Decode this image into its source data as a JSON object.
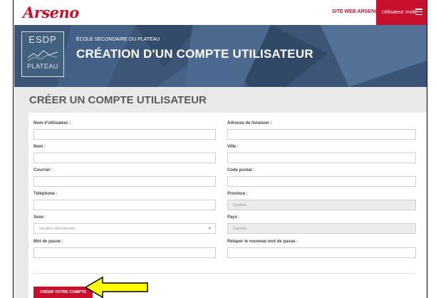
{
  "brand": {
    "logo": "Arseno",
    "accent": "#c8102e"
  },
  "nav": {
    "site_link": "SITE WEB ARSENO",
    "guest_label": "Utilisateur invité"
  },
  "banner": {
    "crest_top": "ESDP",
    "crest_bottom": "PLATEAU",
    "school": "ÉCOLE SECONDAIRE DU PLATEAU",
    "title": "CRÉATION D'UN COMPTE UTILISATEUR"
  },
  "page": {
    "title": "CRÉER UN COMPTE UTILISATEUR"
  },
  "form": {
    "left": [
      {
        "label": "Nom d'utilisateur :",
        "value": ""
      },
      {
        "label": "Nom :",
        "value": ""
      },
      {
        "label": "Courriel :",
        "value": ""
      },
      {
        "label": "Téléphone :",
        "value": ""
      },
      {
        "label": "Sexe :",
        "value": "Veuillez sélectionner..."
      },
      {
        "label": "Mot de passe :",
        "value": ""
      }
    ],
    "right": [
      {
        "label": "Adresse de livraison :",
        "value": ""
      },
      {
        "label": "Ville :",
        "value": ""
      },
      {
        "label": "Code postal :",
        "value": ""
      },
      {
        "label": "Province :",
        "value": "Québec"
      },
      {
        "label": "Pays :",
        "value": "Canada"
      },
      {
        "label": "Retaper le nouveau mot de passe :",
        "value": ""
      }
    ],
    "submit_label": "CRÉER VOTRE COMPTE"
  },
  "annotation": {
    "arrow_icon": "yellow-arrow-icon",
    "arrow_color": "#ffff00"
  }
}
